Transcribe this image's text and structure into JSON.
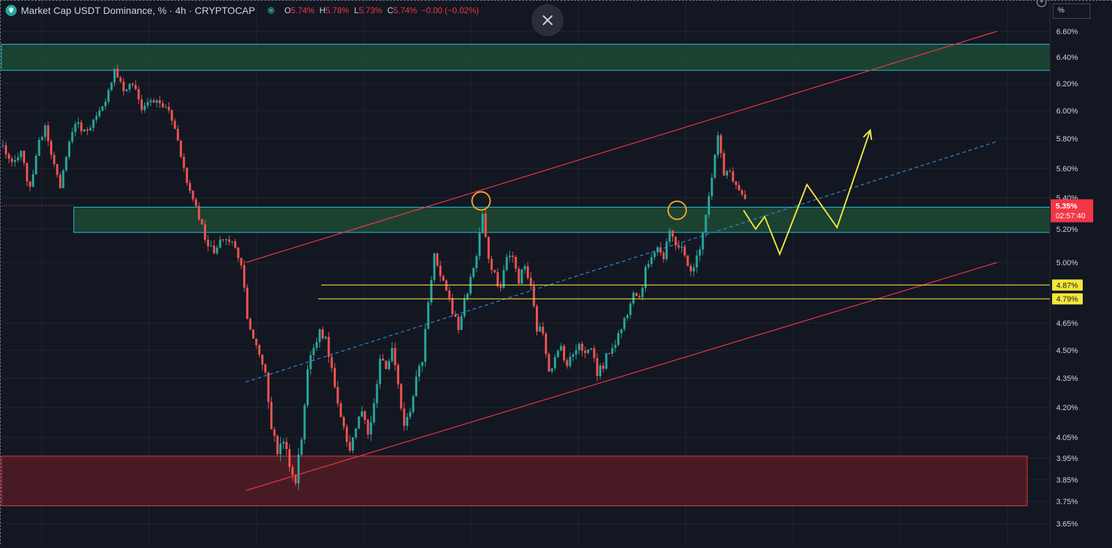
{
  "legend": {
    "title": "Market Cap USDT Dominance, % · 4h · CRYPTOCAP",
    "open_label": "O",
    "open": "5.74%",
    "high_label": "H",
    "high": "5.78%",
    "low_label": "L",
    "low": "5.73%",
    "close_label": "C",
    "close": "5.74%",
    "change": "−0.00 (−0.02%)",
    "symbol_icon": "diamond-icon"
  },
  "scale_mode": "%",
  "colors": {
    "background": "#131722",
    "up": "#26a69a",
    "down": "#ef5350",
    "channel": "#f23645",
    "zone_border": "#22c3d8",
    "zone_fill": "#1e4d36",
    "demand_fill": "#5b1d25",
    "demand_border": "#f23645",
    "level": "#f5e63b",
    "projection": "#f5e63b",
    "midline": "#2f8fe0",
    "pivot": "#f5a623",
    "price_tag": "#f23645"
  },
  "chart_data": {
    "type": "candlestick",
    "title": "Market Cap USDT Dominance, % · 4h · CRYPTOCAP",
    "xlabel": "",
    "ylabel": "",
    "ylim": [
      3.62,
      6.65
    ],
    "y_ticks": [
      "6.60%",
      "6.40%",
      "6.20%",
      "6.00%",
      "5.80%",
      "5.60%",
      "5.40%",
      "5.20%",
      "5.00%",
      "4.65%",
      "4.50%",
      "4.35%",
      "4.20%",
      "4.05%",
      "3.95%",
      "3.85%",
      "3.75%",
      "3.65%"
    ],
    "y_tick_values": [
      6.6,
      6.4,
      6.2,
      6.0,
      5.8,
      5.6,
      5.4,
      5.2,
      5.0,
      4.65,
      4.5,
      4.35,
      4.2,
      4.05,
      3.95,
      3.85,
      3.75,
      3.65
    ],
    "y_axis_scale": "piecewise",
    "bar_count": 350,
    "path_waypoints": [
      [
        0,
        5.75
      ],
      [
        3,
        5.62
      ],
      [
        6,
        5.7
      ],
      [
        9,
        5.45
      ],
      [
        11,
        5.7
      ],
      [
        14,
        5.9
      ],
      [
        17,
        5.62
      ],
      [
        19,
        5.45
      ],
      [
        21,
        5.7
      ],
      [
        24,
        5.92
      ],
      [
        27,
        5.85
      ],
      [
        31,
        5.95
      ],
      [
        34,
        6.05
      ],
      [
        37,
        6.32
      ],
      [
        40,
        6.15
      ],
      [
        43,
        6.2
      ],
      [
        46,
        6.02
      ],
      [
        49,
        6.08
      ],
      [
        52,
        6.05
      ],
      [
        55,
        6.0
      ],
      [
        58,
        5.8
      ],
      [
        61,
        5.5
      ],
      [
        64,
        5.35
      ],
      [
        67,
        5.15
      ],
      [
        70,
        5.05
      ],
      [
        73,
        5.15
      ],
      [
        76,
        5.12
      ],
      [
        79,
        5.0
      ],
      [
        81,
        4.7
      ],
      [
        83,
        4.55
      ],
      [
        85,
        4.48
      ],
      [
        87,
        4.38
      ],
      [
        89,
        4.1
      ],
      [
        91,
        3.98
      ],
      [
        93,
        4.05
      ],
      [
        95,
        3.9
      ],
      [
        97,
        3.85
      ],
      [
        99,
        4.05
      ],
      [
        101,
        4.4
      ],
      [
        103,
        4.52
      ],
      [
        105,
        4.62
      ],
      [
        107,
        4.55
      ],
      [
        109,
        4.4
      ],
      [
        111,
        4.2
      ],
      [
        113,
        4.08
      ],
      [
        115,
        4.0
      ],
      [
        117,
        4.1
      ],
      [
        119,
        4.18
      ],
      [
        121,
        4.05
      ],
      [
        123,
        4.2
      ],
      [
        125,
        4.45
      ],
      [
        127,
        4.4
      ],
      [
        129,
        4.5
      ],
      [
        131,
        4.3
      ],
      [
        133,
        4.12
      ],
      [
        135,
        4.2
      ],
      [
        137,
        4.35
      ],
      [
        139,
        4.45
      ],
      [
        141,
        4.78
      ],
      [
        143,
        5.05
      ],
      [
        145,
        4.9
      ],
      [
        147,
        4.85
      ],
      [
        149,
        4.72
      ],
      [
        151,
        4.62
      ],
      [
        153,
        4.78
      ],
      [
        155,
        4.9
      ],
      [
        157,
        5.05
      ],
      [
        159,
        5.3
      ],
      [
        161,
        5.0
      ],
      [
        163,
        4.92
      ],
      [
        165,
        4.85
      ],
      [
        167,
        5.05
      ],
      [
        169,
        5.02
      ],
      [
        171,
        4.9
      ],
      [
        173,
        4.98
      ],
      [
        175,
        4.85
      ],
      [
        177,
        4.62
      ],
      [
        179,
        4.6
      ],
      [
        181,
        4.4
      ],
      [
        183,
        4.45
      ],
      [
        185,
        4.52
      ],
      [
        187,
        4.42
      ],
      [
        189,
        4.48
      ],
      [
        191,
        4.55
      ],
      [
        193,
        4.48
      ],
      [
        195,
        4.52
      ],
      [
        197,
        4.38
      ],
      [
        199,
        4.42
      ],
      [
        201,
        4.5
      ],
      [
        203,
        4.55
      ],
      [
        205,
        4.62
      ],
      [
        207,
        4.72
      ],
      [
        209,
        4.85
      ],
      [
        211,
        4.8
      ],
      [
        213,
        4.95
      ],
      [
        215,
        5.05
      ],
      [
        217,
        5.1
      ],
      [
        219,
        5.02
      ],
      [
        221,
        5.18
      ],
      [
        223,
        5.12
      ],
      [
        225,
        5.08
      ],
      [
        227,
        4.98
      ],
      [
        229,
        4.96
      ],
      [
        231,
        5.1
      ],
      [
        233,
        5.3
      ],
      [
        235,
        5.55
      ],
      [
        237,
        5.82
      ],
      [
        239,
        5.55
      ],
      [
        241,
        5.58
      ],
      [
        243,
        5.48
      ],
      [
        245,
        5.42
      ],
      [
        246,
        5.38
      ]
    ],
    "lines": [
      {
        "type": "channel-upper",
        "from": [
          81,
          5.0
        ],
        "to": [
          330,
          6.6
        ]
      },
      {
        "type": "channel-lower",
        "from": [
          81,
          3.8
        ],
        "to": [
          330,
          5.0
        ]
      },
      {
        "type": "channel-midline",
        "from": [
          81,
          4.33
        ],
        "to": [
          330,
          5.78
        ]
      }
    ],
    "projection_path": [
      [
        246,
        5.32
      ],
      [
        250,
        5.2
      ],
      [
        253,
        5.28
      ],
      [
        258,
        5.05
      ],
      [
        267,
        5.49
      ],
      [
        277,
        5.21
      ],
      [
        288,
        5.86
      ]
    ],
    "pivot_markers": [
      [
        159,
        5.38
      ],
      [
        224,
        5.32
      ]
    ],
    "zones": [
      {
        "type": "resistance",
        "y_top": 6.5,
        "y_bottom": 6.3,
        "x_start": 0
      },
      {
        "type": "support-resistance",
        "y_top": 5.34,
        "y_bottom": 5.18,
        "x_start": 24
      },
      {
        "type": "demand",
        "y_top": 3.96,
        "y_bottom": 3.73,
        "x_start": 0,
        "x_end": 340
      }
    ],
    "levels": [
      {
        "value": 4.87,
        "label": "4.87%"
      },
      {
        "value": 4.79,
        "label": "4.79%"
      }
    ],
    "last_price": {
      "value": 5.35,
      "label": "5.35%",
      "countdown": "02:57:40"
    },
    "grid": true,
    "legend_position": "top-left"
  }
}
